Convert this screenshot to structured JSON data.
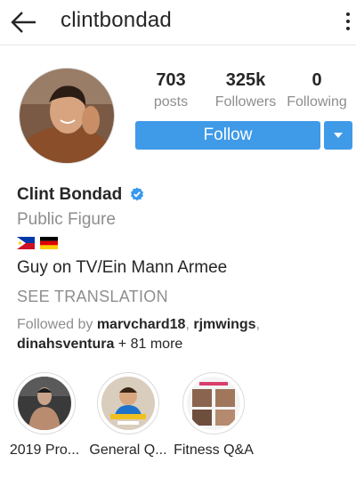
{
  "header": {
    "username": "clintbondad"
  },
  "stats": [
    {
      "value": "703",
      "label": "posts"
    },
    {
      "value": "325k",
      "label": "Followers"
    },
    {
      "value": "0",
      "label": "Following"
    }
  ],
  "actions": {
    "follow_label": "Follow"
  },
  "profile": {
    "name": "Clint Bondad",
    "category": "Public Figure",
    "flags": [
      "philippines-flag",
      "germany-flag"
    ],
    "bio": "Guy on TV/Ein Mann Armee",
    "see_translation": "SEE TRANSLATION",
    "followed_by_prefix": "Followed by ",
    "followed_by_users": [
      "marvchard18",
      "rjmwings",
      "dinahsventura"
    ],
    "followed_by_more": " + 81 more"
  },
  "highlights": [
    {
      "label": "2019 Pro..."
    },
    {
      "label": "General Q..."
    },
    {
      "label": "Fitness Q&A"
    }
  ],
  "colors": {
    "accent": "#3f9ae8",
    "secondary_text": "#8e8e8e",
    "primary_text": "#262626"
  },
  "icons": {
    "back": "arrow-left-icon",
    "more": "vertical-dots-icon",
    "verified": "verified-badge-icon",
    "dropdown": "chevron-down-icon"
  }
}
